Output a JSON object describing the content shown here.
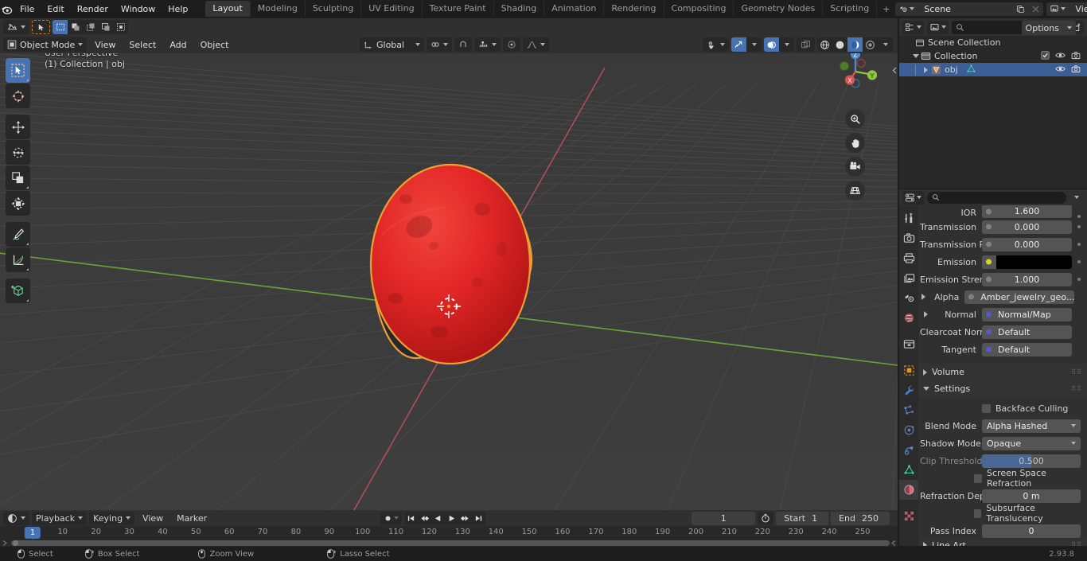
{
  "app": {
    "version": "2.93.8",
    "logo": "blender-logo"
  },
  "topbar": {
    "menus": [
      "File",
      "Edit",
      "Render",
      "Window",
      "Help"
    ],
    "workspaces": [
      {
        "label": "Layout",
        "active": true
      },
      {
        "label": "Modeling",
        "active": false
      },
      {
        "label": "Sculpting",
        "active": false
      },
      {
        "label": "UV Editing",
        "active": false
      },
      {
        "label": "Texture Paint",
        "active": false
      },
      {
        "label": "Shading",
        "active": false
      },
      {
        "label": "Animation",
        "active": false
      },
      {
        "label": "Rendering",
        "active": false
      },
      {
        "label": "Compositing",
        "active": false
      },
      {
        "label": "Geometry Nodes",
        "active": false
      },
      {
        "label": "Scripting",
        "active": false
      }
    ],
    "add_workspace": "+",
    "scene_name": "Scene",
    "view_layer_name": "View Layer"
  },
  "viewport_header": {
    "editor_type": "editor-type-3dview",
    "mode": "Object Mode",
    "menus": [
      "View",
      "Select",
      "Add",
      "Object"
    ],
    "transform_orientation": "Global",
    "options_label": "Options",
    "snap_icon": "magnet-icon",
    "proportional_icon": "proportional-edit-icon",
    "pivot_icon": "pivot-point-icon"
  },
  "viewport": {
    "perspective_label": "User Perspective",
    "scene_info": "(1) Collection | obj",
    "gizmo_axes": [
      "X",
      "Y",
      "Z"
    ],
    "tools": [
      {
        "name": "tweak-select-tool",
        "active": true
      },
      {
        "name": "cursor-tool",
        "active": false
      },
      {
        "name": "move-tool",
        "active": false
      },
      {
        "name": "rotate-tool",
        "active": false
      },
      {
        "name": "scale-tool",
        "active": false
      },
      {
        "name": "transform-tool",
        "active": false
      },
      {
        "name": "annotate-tool",
        "active": false
      },
      {
        "name": "measure-tool",
        "active": false
      },
      {
        "name": "add-cube-tool",
        "active": false
      }
    ],
    "nav_buttons": [
      "zoom-view-icon",
      "pan-view-icon",
      "camera-view-icon",
      "toggle-perspective-icon"
    ],
    "object_colors": {
      "gem": "#e32727",
      "outline": "#ed9e35",
      "band": "#2a2e33",
      "background": "#3b3b3b",
      "x_axis": "#b54a55",
      "y_axis": "#6fa83a"
    }
  },
  "outliner": {
    "display_mode": "view-layer-icon",
    "filter_icon": "filter-icon",
    "new_collection_icon": "new-collection-icon",
    "search_placeholder": "",
    "rows": [
      {
        "label": "Scene Collection",
        "indent": 0,
        "icon": "scene-collection-icon",
        "selected": false,
        "has_disclosure": false,
        "checkbox": false,
        "eye": false,
        "camera": false
      },
      {
        "label": "Collection",
        "indent": 1,
        "icon": "collection-icon",
        "selected": false,
        "has_disclosure": true,
        "checkbox": true,
        "eye": true,
        "camera": true
      },
      {
        "label": "obj",
        "indent": 2,
        "icon": "mesh-object-icon",
        "selected": true,
        "has_disclosure": true,
        "checkbox": false,
        "eye": true,
        "camera": true
      }
    ]
  },
  "properties": {
    "editor_icon": "properties-editor-icon",
    "search_placeholder": "",
    "tabs": [
      {
        "name": "tool-tab",
        "icon": "tool-icon",
        "active": false
      },
      {
        "name": "render-tab",
        "icon": "render-camera-icon",
        "active": false
      },
      {
        "name": "output-tab",
        "icon": "printer-icon",
        "active": false
      },
      {
        "name": "view-layer-tab",
        "icon": "images-icon",
        "active": false
      },
      {
        "name": "scene-tab",
        "icon": "scene-icon",
        "active": false
      },
      {
        "name": "world-tab",
        "icon": "world-globe-icon",
        "active": false
      },
      {
        "name": "collection-tab",
        "icon": "collection-box-icon",
        "active": false
      },
      {
        "name": "object-tab",
        "icon": "object-square-icon",
        "active": false
      },
      {
        "name": "modifier-tab",
        "icon": "wrench-icon",
        "active": false
      },
      {
        "name": "particles-tab",
        "icon": "particles-icon",
        "active": false
      },
      {
        "name": "physics-tab",
        "icon": "physics-orbit-icon",
        "active": false
      },
      {
        "name": "constraints-tab",
        "icon": "constraint-icon",
        "active": false
      },
      {
        "name": "data-tab",
        "icon": "mesh-data-triangle-icon",
        "active": false
      },
      {
        "name": "material-tab",
        "icon": "material-sphere-icon",
        "active": true
      },
      {
        "name": "texture-tab",
        "icon": "texture-checker-icon",
        "active": false
      }
    ],
    "surface_rows": [
      {
        "label": "IOR",
        "value": "1.600",
        "type": "number",
        "socket": "#808080",
        "clipped": true
      },
      {
        "label": "Transmission",
        "value": "0.000",
        "type": "number",
        "socket": "#808080"
      },
      {
        "label": "Transmission R...",
        "value": "0.000",
        "type": "number",
        "socket": "#808080"
      },
      {
        "label": "Emission",
        "value": "",
        "type": "color",
        "socket": "#d9d42a",
        "color": "#000000"
      },
      {
        "label": "Emission Strengt",
        "value": "1.000",
        "type": "number",
        "socket": "#808080"
      },
      {
        "label": "Alpha",
        "value": "Amber_jewelry_geo...",
        "type": "link",
        "socket": "#808080",
        "expandable": true
      },
      {
        "label": "Normal",
        "value": "Normal/Map",
        "type": "link",
        "socket": "#5656cd",
        "expandable": true
      },
      {
        "label": "Clearcoat Normal",
        "value": "Default",
        "type": "link",
        "socket": "#5656cd"
      },
      {
        "label": "Tangent",
        "value": "Default",
        "type": "link",
        "socket": "#5656cd"
      }
    ],
    "panels": [
      {
        "label": "Volume",
        "open": false
      },
      {
        "label": "Settings",
        "open": true
      },
      {
        "label": "Line Art",
        "open": false
      }
    ],
    "settings": {
      "backface_culling_label": "Backface Culling",
      "backface_culling_checked": false,
      "blend_mode_label": "Blend Mode",
      "blend_mode_value": "Alpha Hashed",
      "shadow_mode_label": "Shadow Mode",
      "shadow_mode_value": "Opaque",
      "clip_threshold_label": "Clip Threshold",
      "clip_threshold_value": "0.500",
      "clip_threshold_fill": 50,
      "screen_space_refraction_label": "Screen Space Refraction",
      "screen_space_refraction_checked": false,
      "refraction_depth_label": "Refraction Depth",
      "refraction_depth_value": "0 m",
      "subsurface_translucency_label": "Subsurface Translucency",
      "subsurface_translucency_checked": false,
      "pass_index_label": "Pass Index",
      "pass_index_value": "0"
    }
  },
  "timeline": {
    "editor_icon": "timeline-editor-icon",
    "menus": [
      "Playback",
      "Keying",
      "View",
      "Marker"
    ],
    "record_icon": "auto-keyframe-icon",
    "transport": [
      "jump-to-start-icon",
      "prev-keyframe-icon",
      "play-reverse-icon",
      "play-icon",
      "next-keyframe-icon",
      "jump-to-end-icon"
    ],
    "current_frame": "1",
    "use_preview_range_icon": "stopwatch-icon",
    "start_label": "Start",
    "start_value": "1",
    "end_label": "End",
    "end_value": "250",
    "ticks": [
      10,
      20,
      30,
      40,
      50,
      60,
      70,
      80,
      90,
      100,
      110,
      120,
      130,
      140,
      150,
      160,
      170,
      180,
      190,
      200,
      210,
      220,
      230,
      240,
      250
    ],
    "playhead_frame": "1"
  },
  "status_bar": {
    "items": [
      {
        "icon": "mouse-left-icon",
        "label": "Select"
      },
      {
        "icon": "mouse-left-drag-icon",
        "label": "Box Select"
      },
      {
        "icon": "mouse-middle-icon",
        "label": "Zoom View"
      },
      {
        "icon": "mouse-left-drag-icon",
        "label": "Lasso Select"
      }
    ],
    "version": "2.93.8"
  }
}
